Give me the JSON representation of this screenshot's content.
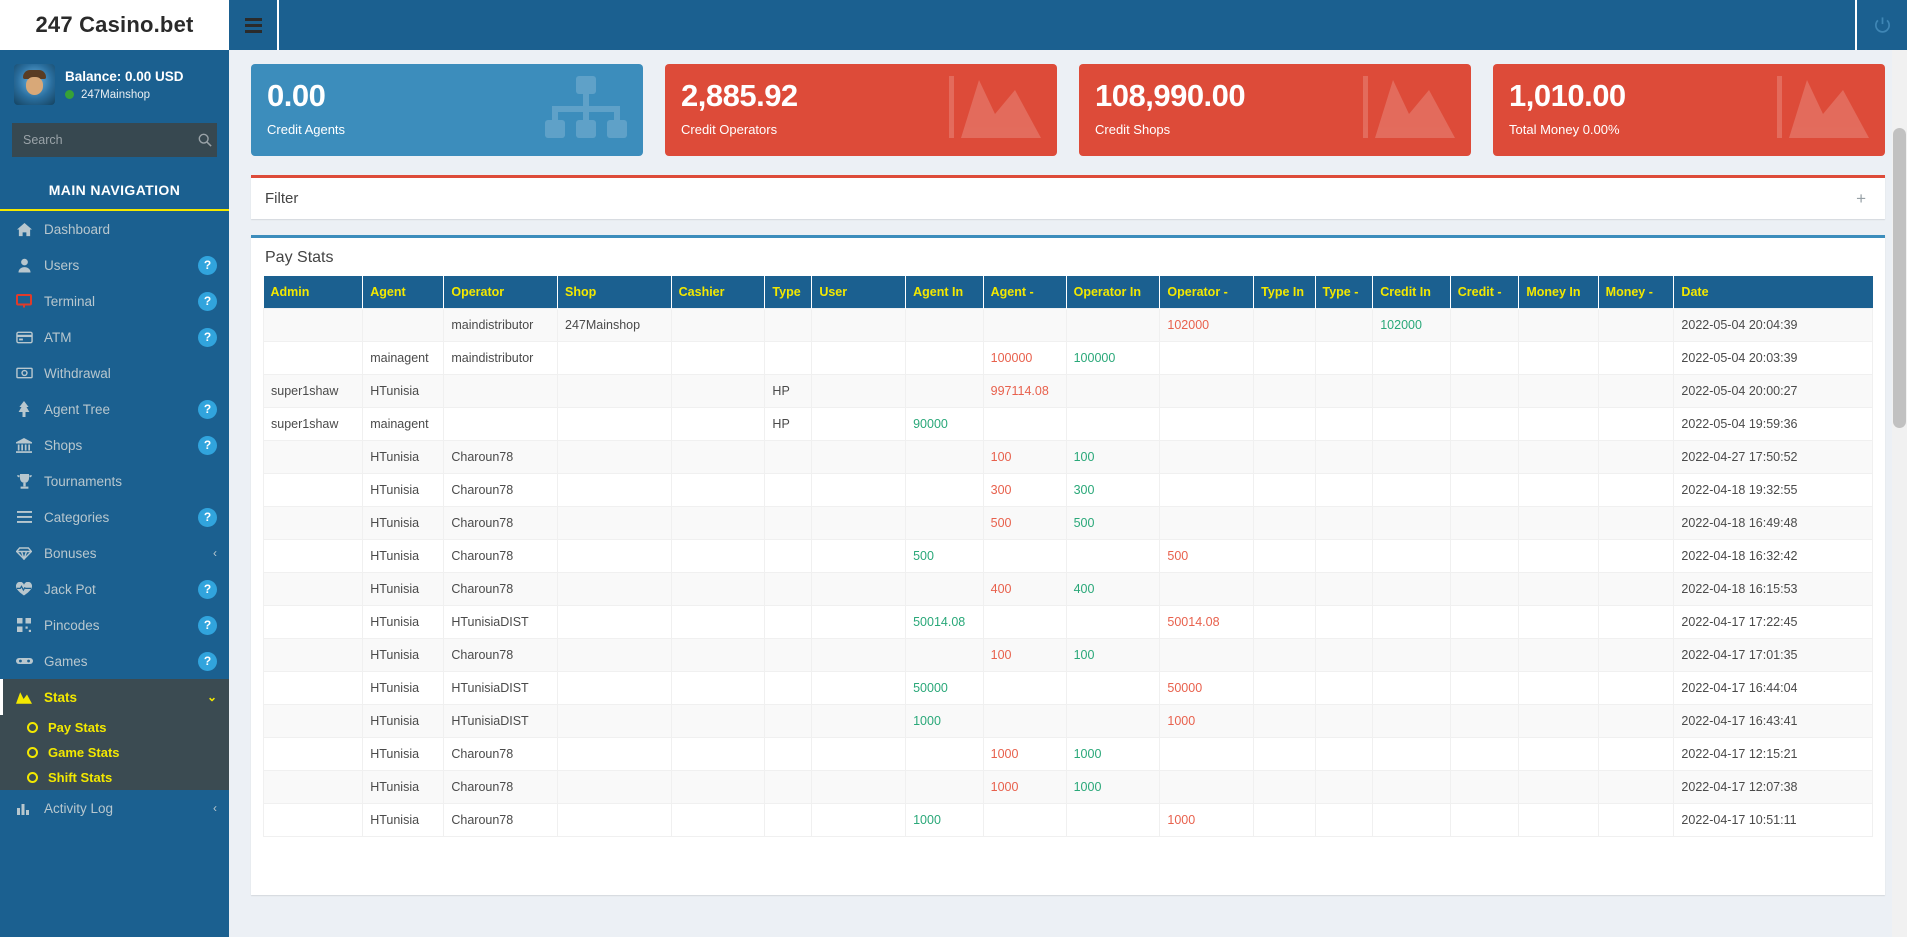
{
  "sidebar": {
    "logo": "247 Casino.bet",
    "user": {
      "balance": "Balance: 0.00 USD",
      "shop": "247Mainshop"
    },
    "search": {
      "placeholder": "Search",
      "value": "",
      "icon": "search-icon"
    },
    "nav_header": "MAIN NAVIGATION",
    "items": [
      {
        "label": "Dashboard",
        "icon": "home-icon",
        "badge": ""
      },
      {
        "label": "Users",
        "icon": "user-icon",
        "badge": "?"
      },
      {
        "label": "Terminal",
        "icon": "monitor-icon",
        "badge": "?"
      },
      {
        "label": "ATM",
        "icon": "card-icon",
        "badge": "?"
      },
      {
        "label": "Withdrawal",
        "icon": "money-icon",
        "badge": ""
      },
      {
        "label": "Agent Tree",
        "icon": "tree-icon",
        "badge": "?"
      },
      {
        "label": "Shops",
        "icon": "bank-icon",
        "badge": "?"
      },
      {
        "label": "Tournaments",
        "icon": "trophy-icon",
        "badge": ""
      },
      {
        "label": "Categories",
        "icon": "list-icon",
        "badge": "?"
      },
      {
        "label": "Bonuses",
        "icon": "gem-icon",
        "badge": "chevron-left-icon"
      },
      {
        "label": "Jack Pot",
        "icon": "heartbeat-icon",
        "badge": "?"
      },
      {
        "label": "Pincodes",
        "icon": "qrcode-icon",
        "badge": "?"
      },
      {
        "label": "Games",
        "icon": "gamepad-icon",
        "badge": "?"
      }
    ],
    "stats": {
      "label": "Stats",
      "icon": "chart-area-icon",
      "chevron": "chevron-down-icon",
      "children": [
        {
          "label": "Pay Stats"
        },
        {
          "label": "Game Stats"
        },
        {
          "label": "Shift Stats"
        }
      ]
    },
    "activity": {
      "label": "Activity Log",
      "icon": "bar-chart-icon",
      "chevron": "chevron-left-icon"
    },
    "colors": {
      "bg": "#1b6090",
      "accent": "#f3e800",
      "active_bg": "#3b4b52"
    }
  },
  "topbar": {
    "menu_icon": "hamburger-icon",
    "power_icon": "power-off-icon"
  },
  "infoboxes": [
    {
      "value": "0.00",
      "caption": "Credit Agents",
      "color": "#3c8dbc",
      "art": "sitemap-icon"
    },
    {
      "value": "2,885.92",
      "caption": "Credit Operators",
      "color": "#dd4b39",
      "art": "chart-area-icon"
    },
    {
      "value": "108,990.00",
      "caption": "Credit Shops",
      "color": "#dd4b39",
      "art": "chart-area-icon"
    },
    {
      "value": "1,010.00",
      "caption": "Total Money 0.00%",
      "color": "#dd4b39",
      "art": "chart-area-icon"
    }
  ],
  "filter": {
    "title": "Filter",
    "expand_label": "+"
  },
  "table": {
    "title": "Pay Stats",
    "columns": [
      "Admin",
      "Agent",
      "Operator",
      "Shop",
      "Cashier",
      "Type",
      "User",
      "Agent In",
      "Agent -",
      "Operator In",
      "Operator -",
      "Type In",
      "Type -",
      "Credit In",
      "Credit -",
      "Money In",
      "Money -",
      "Date"
    ],
    "rows": [
      {
        "admin": "",
        "agent": "",
        "operator": "maindistributor",
        "shop": "247Mainshop",
        "cashier": "",
        "type": "",
        "user": "",
        "agent_in": "",
        "agent_out": "",
        "operator_in": "",
        "operator_out": "102000",
        "type_in": "",
        "type_out": "",
        "credit_in": "102000",
        "credit_out": "",
        "money_in": "",
        "money_out": "",
        "date": "2022-05-04 20:04:39"
      },
      {
        "admin": "",
        "agent": "mainagent",
        "operator": "maindistributor",
        "shop": "",
        "cashier": "",
        "type": "",
        "user": "",
        "agent_in": "",
        "agent_out": "100000",
        "operator_in": "100000",
        "operator_out": "",
        "type_in": "",
        "type_out": "",
        "credit_in": "",
        "credit_out": "",
        "money_in": "",
        "money_out": "",
        "date": "2022-05-04 20:03:39"
      },
      {
        "admin": "super1shaw",
        "agent": "HTunisia",
        "operator": "",
        "shop": "",
        "cashier": "",
        "type": "HP",
        "user": "",
        "agent_in": "",
        "agent_out": "997114.08",
        "operator_in": "",
        "operator_out": "",
        "type_in": "",
        "type_out": "",
        "credit_in": "",
        "credit_out": "",
        "money_in": "",
        "money_out": "",
        "date": "2022-05-04 20:00:27"
      },
      {
        "admin": "super1shaw",
        "agent": "mainagent",
        "operator": "",
        "shop": "",
        "cashier": "",
        "type": "HP",
        "user": "",
        "agent_in": "90000",
        "agent_out": "",
        "operator_in": "",
        "operator_out": "",
        "type_in": "",
        "type_out": "",
        "credit_in": "",
        "credit_out": "",
        "money_in": "",
        "money_out": "",
        "date": "2022-05-04 19:59:36"
      },
      {
        "admin": "",
        "agent": "HTunisia",
        "operator": "Charoun78",
        "shop": "",
        "cashier": "",
        "type": "",
        "user": "",
        "agent_in": "",
        "agent_out": "100",
        "operator_in": "100",
        "operator_out": "",
        "type_in": "",
        "type_out": "",
        "credit_in": "",
        "credit_out": "",
        "money_in": "",
        "money_out": "",
        "date": "2022-04-27 17:50:52"
      },
      {
        "admin": "",
        "agent": "HTunisia",
        "operator": "Charoun78",
        "shop": "",
        "cashier": "",
        "type": "",
        "user": "",
        "agent_in": "",
        "agent_out": "300",
        "operator_in": "300",
        "operator_out": "",
        "type_in": "",
        "type_out": "",
        "credit_in": "",
        "credit_out": "",
        "money_in": "",
        "money_out": "",
        "date": "2022-04-18 19:32:55"
      },
      {
        "admin": "",
        "agent": "HTunisia",
        "operator": "Charoun78",
        "shop": "",
        "cashier": "",
        "type": "",
        "user": "",
        "agent_in": "",
        "agent_out": "500",
        "operator_in": "500",
        "operator_out": "",
        "type_in": "",
        "type_out": "",
        "credit_in": "",
        "credit_out": "",
        "money_in": "",
        "money_out": "",
        "date": "2022-04-18 16:49:48"
      },
      {
        "admin": "",
        "agent": "HTunisia",
        "operator": "Charoun78",
        "shop": "",
        "cashier": "",
        "type": "",
        "user": "",
        "agent_in": "500",
        "agent_out": "",
        "operator_in": "",
        "operator_out": "500",
        "type_in": "",
        "type_out": "",
        "credit_in": "",
        "credit_out": "",
        "money_in": "",
        "money_out": "",
        "date": "2022-04-18 16:32:42"
      },
      {
        "admin": "",
        "agent": "HTunisia",
        "operator": "Charoun78",
        "shop": "",
        "cashier": "",
        "type": "",
        "user": "",
        "agent_in": "",
        "agent_out": "400",
        "operator_in": "400",
        "operator_out": "",
        "type_in": "",
        "type_out": "",
        "credit_in": "",
        "credit_out": "",
        "money_in": "",
        "money_out": "",
        "date": "2022-04-18 16:15:53"
      },
      {
        "admin": "",
        "agent": "HTunisia",
        "operator": "HTunisiaDIST",
        "shop": "",
        "cashier": "",
        "type": "",
        "user": "",
        "agent_in": "50014.08",
        "agent_out": "",
        "operator_in": "",
        "operator_out": "50014.08",
        "type_in": "",
        "type_out": "",
        "credit_in": "",
        "credit_out": "",
        "money_in": "",
        "money_out": "",
        "date": "2022-04-17 17:22:45"
      },
      {
        "admin": "",
        "agent": "HTunisia",
        "operator": "Charoun78",
        "shop": "",
        "cashier": "",
        "type": "",
        "user": "",
        "agent_in": "",
        "agent_out": "100",
        "operator_in": "100",
        "operator_out": "",
        "type_in": "",
        "type_out": "",
        "credit_in": "",
        "credit_out": "",
        "money_in": "",
        "money_out": "",
        "date": "2022-04-17 17:01:35"
      },
      {
        "admin": "",
        "agent": "HTunisia",
        "operator": "HTunisiaDIST",
        "shop": "",
        "cashier": "",
        "type": "",
        "user": "",
        "agent_in": "50000",
        "agent_out": "",
        "operator_in": "",
        "operator_out": "50000",
        "type_in": "",
        "type_out": "",
        "credit_in": "",
        "credit_out": "",
        "money_in": "",
        "money_out": "",
        "date": "2022-04-17 16:44:04"
      },
      {
        "admin": "",
        "agent": "HTunisia",
        "operator": "HTunisiaDIST",
        "shop": "",
        "cashier": "",
        "type": "",
        "user": "",
        "agent_in": "1000",
        "agent_out": "",
        "operator_in": "",
        "operator_out": "1000",
        "type_in": "",
        "type_out": "",
        "credit_in": "",
        "credit_out": "",
        "money_in": "",
        "money_out": "",
        "date": "2022-04-17 16:43:41"
      },
      {
        "admin": "",
        "agent": "HTunisia",
        "operator": "Charoun78",
        "shop": "",
        "cashier": "",
        "type": "",
        "user": "",
        "agent_in": "",
        "agent_out": "1000",
        "operator_in": "1000",
        "operator_out": "",
        "type_in": "",
        "type_out": "",
        "credit_in": "",
        "credit_out": "",
        "money_in": "",
        "money_out": "",
        "date": "2022-04-17 12:15:21"
      },
      {
        "admin": "",
        "agent": "HTunisia",
        "operator": "Charoun78",
        "shop": "",
        "cashier": "",
        "type": "",
        "user": "",
        "agent_in": "",
        "agent_out": "1000",
        "operator_in": "1000",
        "operator_out": "",
        "type_in": "",
        "type_out": "",
        "credit_in": "",
        "credit_out": "",
        "money_in": "",
        "money_out": "",
        "date": "2022-04-17 12:07:38"
      },
      {
        "admin": "",
        "agent": "HTunisia",
        "operator": "Charoun78",
        "shop": "",
        "cashier": "",
        "type": "",
        "user": "",
        "agent_in": "1000",
        "agent_out": "",
        "operator_in": "",
        "operator_out": "1000",
        "type_in": "",
        "type_out": "",
        "credit_in": "",
        "credit_out": "",
        "money_in": "",
        "money_out": "",
        "date": "2022-04-17 10:51:11"
      }
    ]
  }
}
